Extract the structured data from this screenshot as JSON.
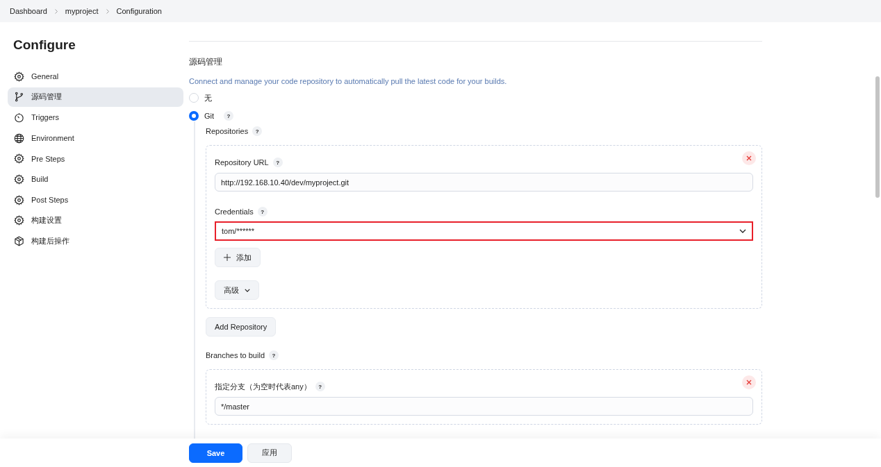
{
  "breadcrumb": [
    "Dashboard",
    "myproject",
    "Configuration"
  ],
  "sidebar": {
    "title": "Configure",
    "items": [
      {
        "label": "General",
        "selected": false
      },
      {
        "label": "源码管理",
        "selected": true
      },
      {
        "label": "Triggers",
        "selected": false
      },
      {
        "label": "Environment",
        "selected": false
      },
      {
        "label": "Pre Steps",
        "selected": false
      },
      {
        "label": "Build",
        "selected": false
      },
      {
        "label": "Post Steps",
        "selected": false
      },
      {
        "label": "构建设置",
        "selected": false
      },
      {
        "label": "构建后操作",
        "selected": false
      }
    ]
  },
  "section": {
    "title": "源码管理",
    "description": "Connect and manage your code repository to automatically pull the latest code for your builds.",
    "options": [
      {
        "label": "无",
        "selected": false
      },
      {
        "label": "Git",
        "help": "?",
        "selected": true
      }
    ],
    "git": {
      "repositories_label": "Repositories",
      "repositories_help": "?",
      "repository": {
        "url_label": "Repository URL",
        "url_help": "?",
        "url": "http://192.168.10.40/dev/myproject.git",
        "credentials_label": "Credentials",
        "credentials_help": "?",
        "credentials": "tom/******",
        "highlighted": true,
        "add_button": "添加",
        "advanced_button": "高级"
      },
      "add_repository_button": "Add Repository",
      "branches_label": "Branches to build",
      "branches_help": "?",
      "branch": {
        "label": "指定分支（为空时代表any）",
        "help": "?",
        "value": "*/master"
      }
    }
  },
  "footer": {
    "buttons": [
      {
        "label": "Save",
        "kind": "primary"
      },
      {
        "label": "应用",
        "kind": "secondary"
      }
    ]
  }
}
